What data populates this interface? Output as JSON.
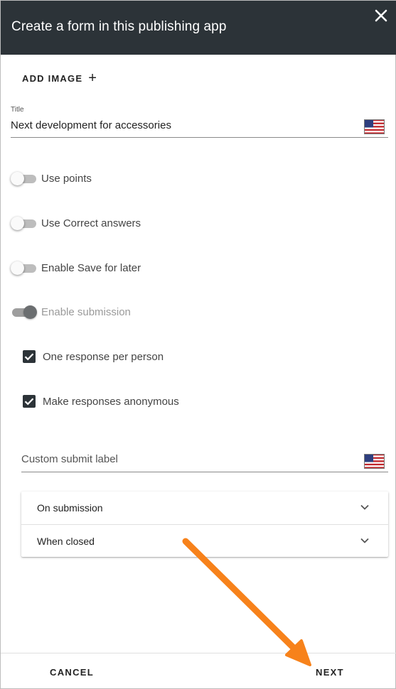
{
  "header": {
    "title": "Create a form in this publishing app",
    "close_icon": "close-icon"
  },
  "add_image": {
    "label": "ADD IMAGE",
    "icon": "plus-icon",
    "plus": "+"
  },
  "title_field": {
    "label": "Title",
    "value": "Next development for accessories",
    "flag_icon": "us-flag-icon"
  },
  "toggles": [
    {
      "label": "Use points",
      "on": false
    },
    {
      "label": "Use Correct answers",
      "on": false
    },
    {
      "label": "Enable Save for later",
      "on": false
    },
    {
      "label": "Enable submission",
      "on": true,
      "disabled": true
    }
  ],
  "checkboxes": [
    {
      "label": "One response per person",
      "checked": true
    },
    {
      "label": "Make responses anonymous",
      "checked": true
    }
  ],
  "submit_field": {
    "placeholder": "Custom submit label",
    "flag_icon": "us-flag-icon"
  },
  "panels": [
    {
      "label": "On submission",
      "icon": "chevron-down-icon"
    },
    {
      "label": "When closed",
      "icon": "chevron-down-icon"
    }
  ],
  "footer": {
    "cancel_label": "CANCEL",
    "next_label": "NEXT"
  },
  "colors": {
    "header_bg": "#2c3338",
    "accent_arrow": "#f7821b",
    "checkbox_fill": "#2c3338"
  }
}
